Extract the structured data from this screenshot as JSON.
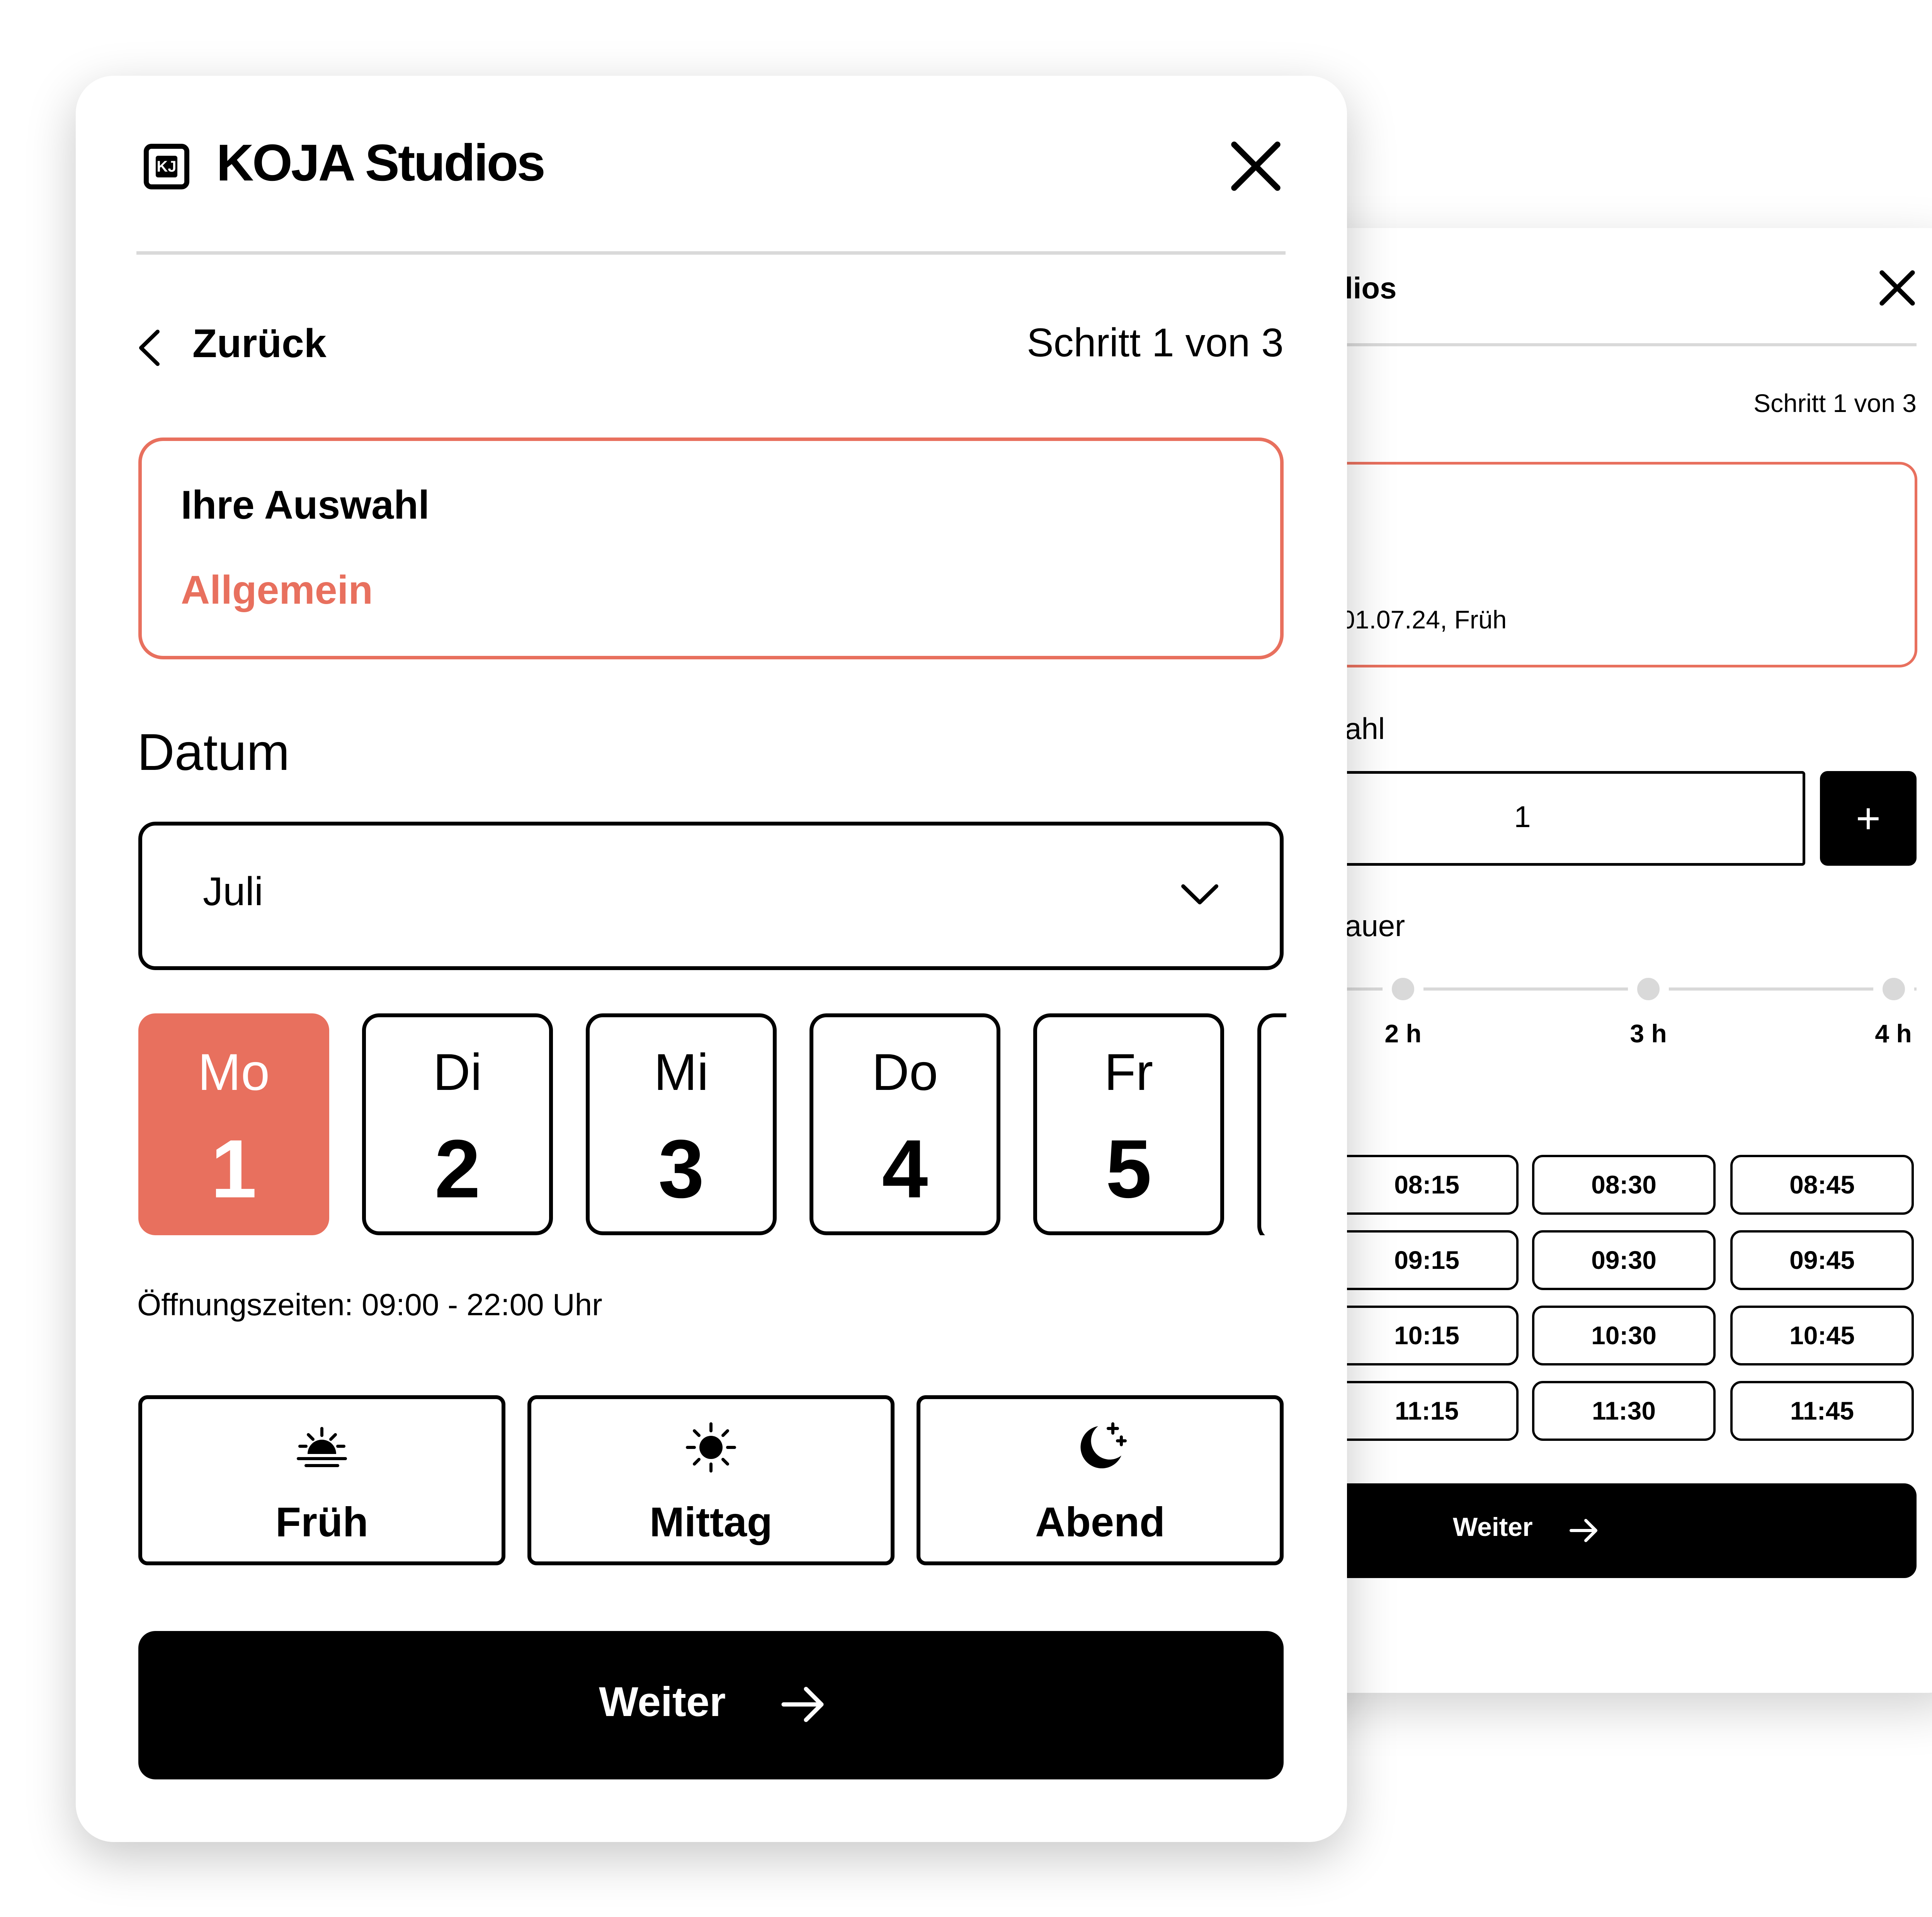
{
  "colors": {
    "accent": "#e8705e",
    "primary": "#000000",
    "divider": "#d9d9d9",
    "surface": "#ffffff"
  },
  "back_card": {
    "title_fragment": "lios",
    "close_icon": "close-icon",
    "step": "Schritt 1 von 3",
    "selection_summary": "01.07.24, Früh",
    "quantity_label_fragment": "ahl",
    "quantity_value": "1",
    "plus_label": "+",
    "duration_label_fragment": "auer",
    "duration_options": [
      "2 h",
      "3 h",
      "4 h"
    ],
    "time_slots": [
      [
        "08:15",
        "08:30",
        "08:45"
      ],
      [
        "09:15",
        "09:30",
        "09:45"
      ],
      [
        "10:15",
        "10:30",
        "10:45"
      ],
      [
        "11:15",
        "11:30",
        "11:45"
      ]
    ],
    "next_label": "Weiter"
  },
  "front_card": {
    "logo_mark": "KJ",
    "brand": "KOJA Studios",
    "close_icon": "close-icon",
    "back_label": "Zurück",
    "step": "Schritt 1 von 3",
    "selection_title": "Ihre Auswahl",
    "selection_value": "Allgemein",
    "date_label": "Datum",
    "month_value": "Juli",
    "days": [
      {
        "name": "Mo",
        "num": "1",
        "selected": true
      },
      {
        "name": "Di",
        "num": "2",
        "selected": false
      },
      {
        "name": "Mi",
        "num": "3",
        "selected": false
      },
      {
        "name": "Do",
        "num": "4",
        "selected": false
      },
      {
        "name": "Fr",
        "num": "5",
        "selected": false
      }
    ],
    "opening_hours": "Öffnungszeiten: 09:00 - 22:00 Uhr",
    "time_of_day": [
      {
        "label": "Früh",
        "icon": "sunrise-icon"
      },
      {
        "label": "Mittag",
        "icon": "sun-icon"
      },
      {
        "label": "Abend",
        "icon": "moon-stars-icon"
      }
    ],
    "next_label": "Weiter"
  }
}
